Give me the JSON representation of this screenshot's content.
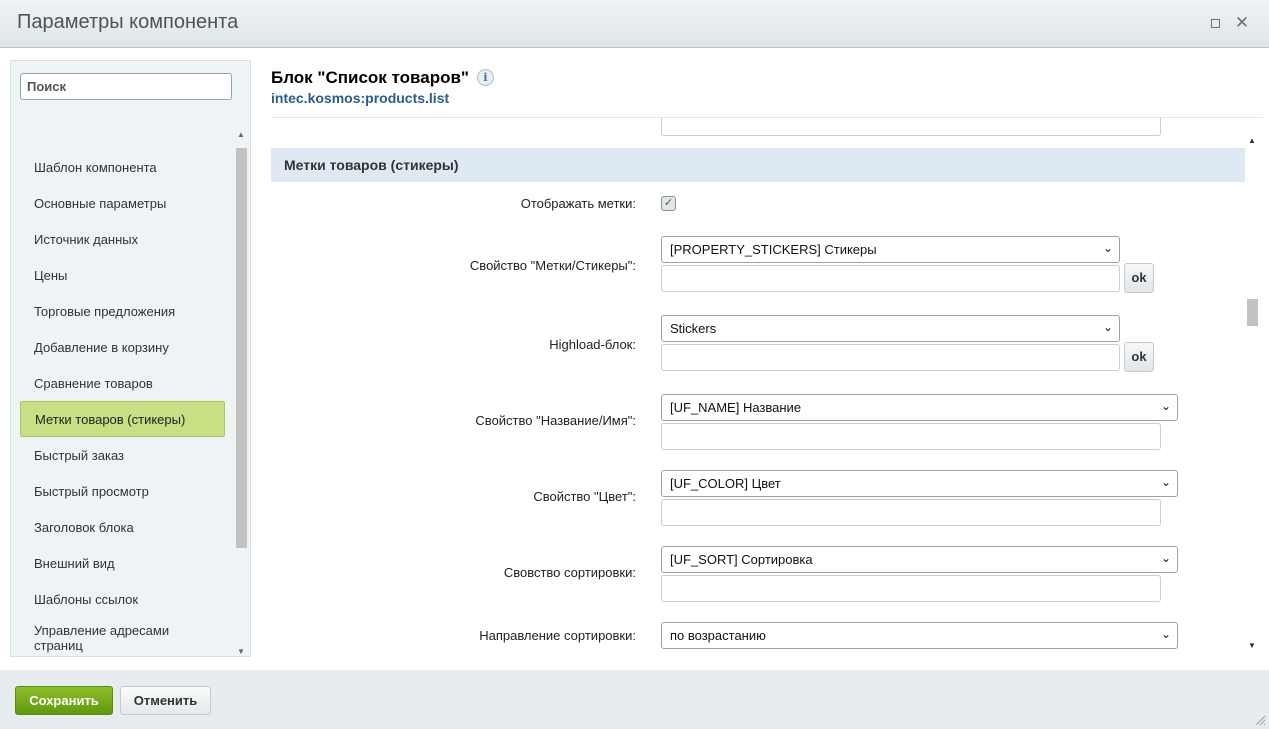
{
  "window": {
    "title": "Параметры компонента",
    "maximize_icon": "square-icon",
    "close_glyph": "✕"
  },
  "sidebar": {
    "search_placeholder": "Поиск",
    "items": [
      {
        "label": "Шаблон компонента"
      },
      {
        "label": "Основные параметры"
      },
      {
        "label": "Источник данных"
      },
      {
        "label": "Цены"
      },
      {
        "label": "Торговые предложения"
      },
      {
        "label": "Добавление в корзину"
      },
      {
        "label": "Сравнение товаров"
      },
      {
        "label": "Метки товаров (стикеры)",
        "active": true
      },
      {
        "label": "Быстрый заказ"
      },
      {
        "label": "Быстрый просмотр"
      },
      {
        "label": "Заголовок блока"
      },
      {
        "label": "Внешний вид"
      },
      {
        "label": "Шаблоны ссылок"
      },
      {
        "label": "Управление адресами страниц"
      }
    ]
  },
  "panel": {
    "title": "Блок \"Список товаров\"",
    "info_glyph": "i",
    "component_id": "intec.kosmos:products.list"
  },
  "section": {
    "title": "Метки товаров (стикеры)",
    "show_labels": {
      "label": "Отображать метки:",
      "checked": true,
      "check_glyph": "✓"
    },
    "stickers_property": {
      "label": "Свойство \"Метки/Стикеры\":",
      "value": "[PROPERTY_STICKERS] Стикеры",
      "ok": "ok"
    },
    "highload_block": {
      "label": "Highload-блок:",
      "value": "Stickers",
      "ok": "ok"
    },
    "name_property": {
      "label": "Свойство \"Название/Имя\":",
      "value": "[UF_NAME] Название"
    },
    "color_property": {
      "label": "Свойство \"Цвет\":",
      "value": "[UF_COLOR] Цвет"
    },
    "sort_property": {
      "label": "Свовство сортировки:",
      "value": "[UF_SORT] Сортировка"
    },
    "sort_direction": {
      "label": "Направление сортировки:",
      "value": "по возрастанию"
    }
  },
  "footer": {
    "save_label": "Сохранить",
    "cancel_label": "Отменить"
  },
  "colors": {
    "active_item": "#c7e084",
    "save_button": "#6ea514",
    "section_header": "#dfe9f3",
    "component_link": "#2a5c8e"
  }
}
